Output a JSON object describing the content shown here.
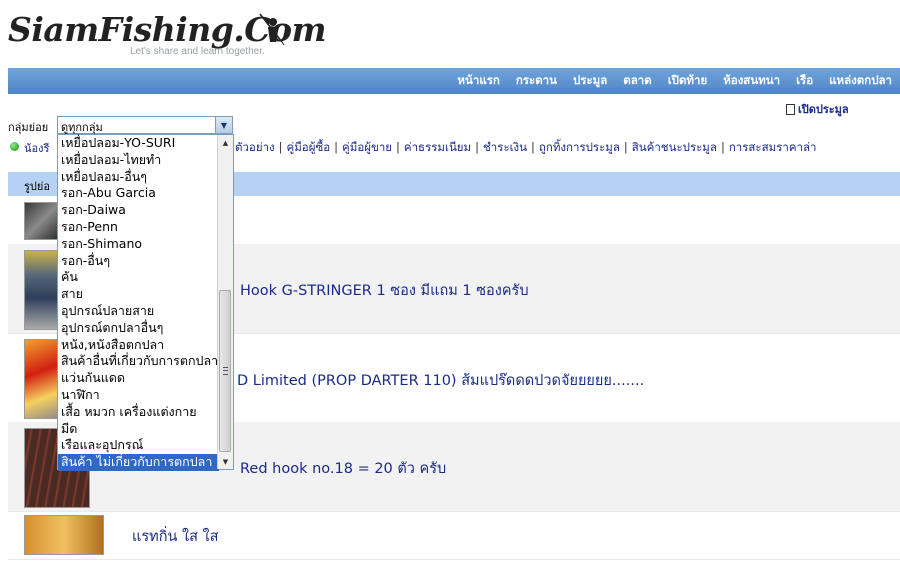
{
  "site": {
    "logo_text": "SiamFishing.Com",
    "tagline": "Let's share and learn together."
  },
  "nav": {
    "items": [
      "หน้าแรก",
      "กระดาน",
      "ประมูล",
      "ตลาด",
      "เปิดท้าย",
      "ห้องสนทนา",
      "เรือ",
      "แหล่งตกปลา"
    ]
  },
  "post_link": "เปิดประมูล",
  "filter": {
    "group_label": "กลุ่มย่อย",
    "selected": "ดูทุกกลุ่ม",
    "first_link": "น้องรี",
    "links": [
      "ตัวอย่าง",
      "คู่มือผู้ซื้อ",
      "คู่มือผู้ขาย",
      "ค่าธรรมเนียม",
      "ชำระเงิน",
      "ถูกทิ้งการประมูล",
      "สินค้าชนะประมูล",
      "การสะสมราคาล่า"
    ]
  },
  "dropdown": {
    "options": [
      "เหยื่อปลอม-YO-SURI",
      "เหยื่อปลอม-ไทยทำ",
      "เหยื่อปลอม-อื่นๆ",
      "รอก-Abu Garcia",
      "รอก-Daiwa",
      "รอก-Penn",
      "รอก-Shimano",
      "รอก-อื่นๆ",
      "คัน",
      "สาย",
      "อุปกรณ์ปลายสาย",
      "อุปกรณ์ตกปลาอื่นๆ",
      "หนัง,หนังสือตกปลา",
      "สินค้าอื่นที่เกี่ยวกับการตกปลา",
      "แว่นกันแดด",
      "นาฬิกา",
      "เสื้อ หมวก เครื่องแต่งกาย",
      "มีด",
      "เรือและอุปกรณ์",
      "สินค้า ไม่เกี่ยวกับการตกปลา"
    ],
    "highlighted_index": 19,
    "scroll_fraction": 0.85
  },
  "table": {
    "header_label": "รูปย่อ",
    "rows": [
      {
        "title": ""
      },
      {
        "title": "Hook G-STRINGER 1 ซอง มีแถม 1 ซองครับ"
      },
      {
        "title": "D Limited (PROP DARTER 110) ส้มแปร๊ดดดปวดจัยยยยย......."
      },
      {
        "title": "Red hook no.18 = 20 ตัว ครับ"
      },
      {
        "title": "แรทกิ่น ใส ใส"
      }
    ]
  },
  "colors": {
    "nav_bg": "#5a8fcf",
    "header_bg": "#b7d1f5",
    "link": "#1a2a8a",
    "highlight": "#3168c5"
  },
  "icons": [
    "fisherman-logo-icon",
    "document-icon",
    "green-dot-icon",
    "dropdown-arrow-icon"
  ]
}
